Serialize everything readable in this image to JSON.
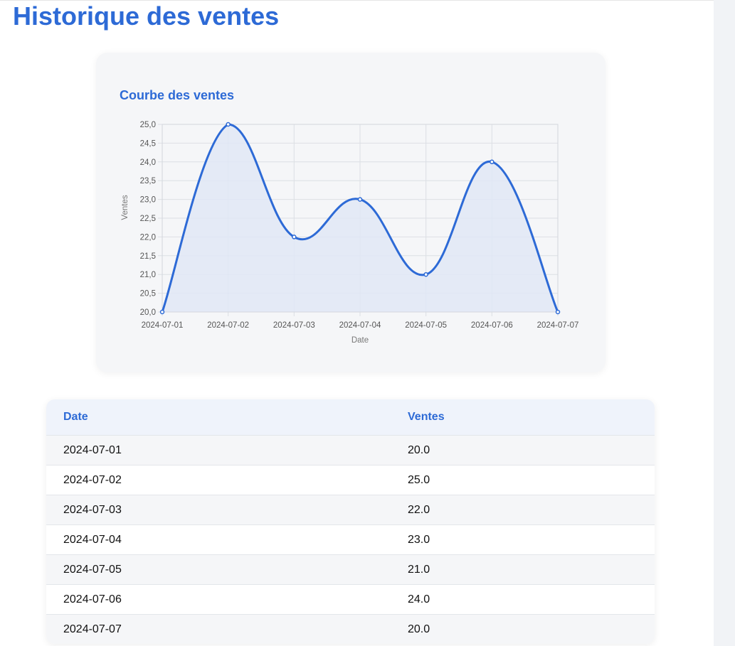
{
  "page": {
    "title": "Historique des ventes"
  },
  "chart_card": {
    "title": "Courbe des ventes"
  },
  "chart_data": {
    "type": "area",
    "title": "Courbe des ventes",
    "xlabel": "Date",
    "ylabel": "Ventes",
    "categories": [
      "2024-07-01",
      "2024-07-02",
      "2024-07-03",
      "2024-07-04",
      "2024-07-05",
      "2024-07-06",
      "2024-07-07"
    ],
    "values": [
      20.0,
      25.0,
      22.0,
      23.0,
      21.0,
      24.0,
      20.0
    ],
    "ylim": [
      20.0,
      25.0
    ],
    "yticks": [
      "20,0",
      "20,5",
      "21,0",
      "21,5",
      "22,0",
      "22,5",
      "23,0",
      "23,5",
      "24,0",
      "24,5",
      "25,0"
    ],
    "grid": true,
    "colors": {
      "line": "#2d6ad6",
      "fill": "#e1e8f6"
    }
  },
  "table": {
    "headers": [
      "Date",
      "Ventes"
    ],
    "rows": [
      [
        "2024-07-01",
        "20.0"
      ],
      [
        "2024-07-02",
        "25.0"
      ],
      [
        "2024-07-03",
        "22.0"
      ],
      [
        "2024-07-04",
        "23.0"
      ],
      [
        "2024-07-05",
        "21.0"
      ],
      [
        "2024-07-06",
        "24.0"
      ],
      [
        "2024-07-07",
        "20.0"
      ]
    ]
  },
  "colors": {
    "accent": "#2d6ad6"
  }
}
